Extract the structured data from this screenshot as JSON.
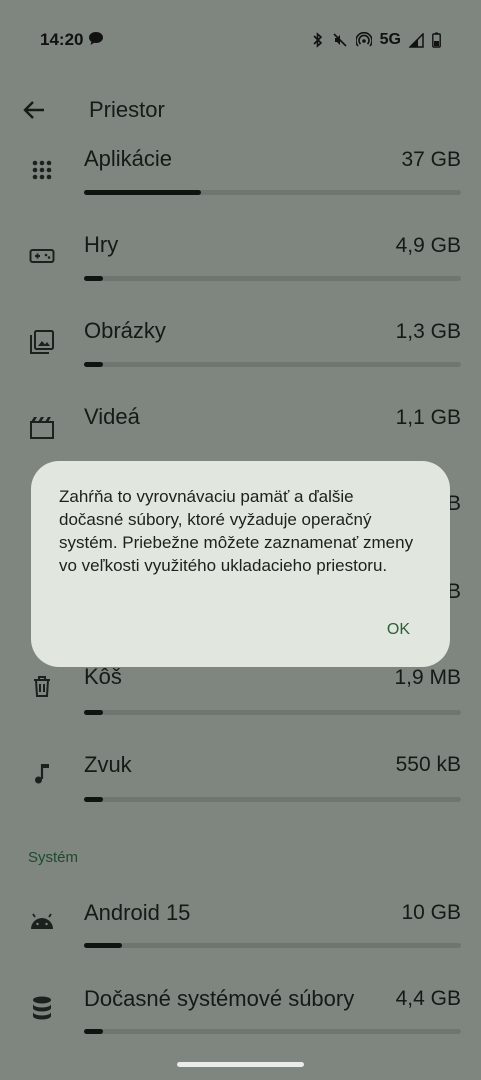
{
  "status": {
    "time": "14:20",
    "network": "5G"
  },
  "appbar": {
    "title": "Priestor"
  },
  "items": [
    {
      "label": "Aplikácie",
      "size": "37 GB",
      "fraction": 0.31,
      "icon": "apps-grid-icon"
    },
    {
      "label": "Hry",
      "size": "4,9 GB",
      "fraction": 0.05,
      "icon": "gamepad-icon"
    },
    {
      "label": "Obrázky",
      "size": "1,3 GB",
      "fraction": 0.03,
      "icon": "photos-icon"
    },
    {
      "label": "Videá",
      "size": "1,1 GB",
      "fraction": 0.0,
      "icon": "movie-icon"
    },
    {
      "label": "Kôš",
      "size": "1,9 MB",
      "fraction": 0.0,
      "icon": "trash-icon"
    },
    {
      "label": "Zvuk",
      "size": "550 kB",
      "fraction": 0.0,
      "icon": "music-note-icon"
    }
  ],
  "system_section": {
    "title": "Systém",
    "items": [
      {
        "label": "Android 15",
        "size": "10 GB",
        "fraction": 0.1,
        "icon": "android-icon"
      },
      {
        "label": "Dočasné systémové súbory",
        "size": "4,4 GB",
        "fraction": 0.05,
        "icon": "database-icon"
      }
    ]
  },
  "partial_sizes": [
    "B",
    "B"
  ],
  "dialog": {
    "message": "Zahŕňa to vyrovnávaciu pamäť a ďalšie dočasné súbory, ktoré vyžaduje operačný systém. Priebežne môžete zaznamenať zmeny vo veľkosti využitého ukladacieho priestoru.",
    "ok_label": "OK"
  },
  "colors": {
    "scrim_background": "#7e867f",
    "dialog_background": "#e1e7de",
    "accent": "#2c5e38",
    "bar_fill": "#101410"
  }
}
